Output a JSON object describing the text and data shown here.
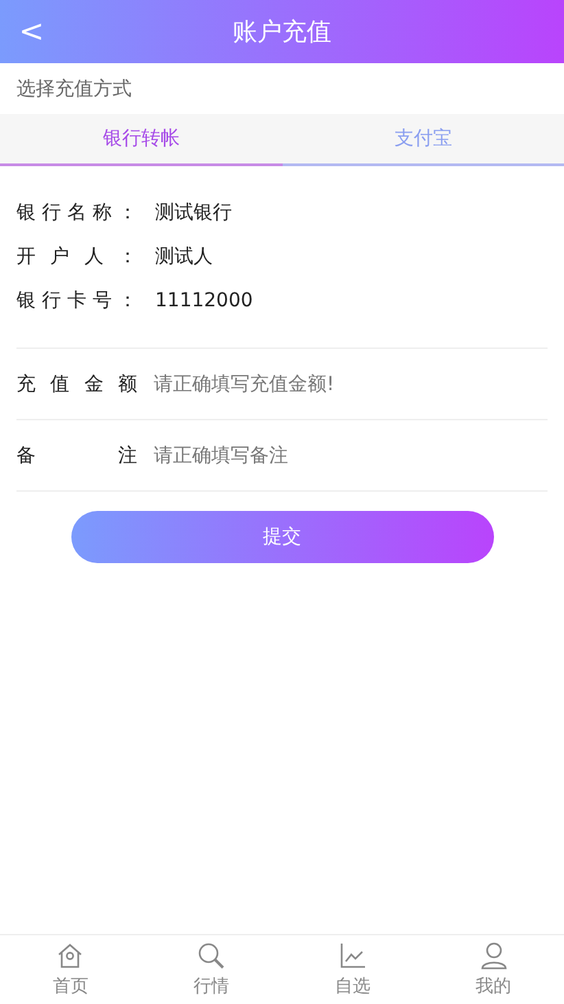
{
  "header": {
    "back": "<",
    "title": "账户充值"
  },
  "section_title": "选择充值方式",
  "tabs": [
    {
      "label": "银行转帐",
      "selected": true
    },
    {
      "label": "支付宝",
      "selected": false
    }
  ],
  "bank_info": [
    {
      "label": "银行名称：",
      "value": "测试银行"
    },
    {
      "label": "开户人：",
      "value": "测试人"
    },
    {
      "label": "银行卡号：",
      "value": "11112000"
    }
  ],
  "form": [
    {
      "label": "充值金额",
      "placeholder": "请正确填写充值金额!"
    },
    {
      "label": "备注",
      "placeholder": "请正确填写备注"
    }
  ],
  "submit": "提交",
  "bottom_nav": [
    {
      "kind": "home",
      "label": "首页"
    },
    {
      "kind": "search",
      "label": "行情"
    },
    {
      "kind": "chart",
      "label": "自选"
    },
    {
      "kind": "user",
      "label": "我的"
    }
  ]
}
